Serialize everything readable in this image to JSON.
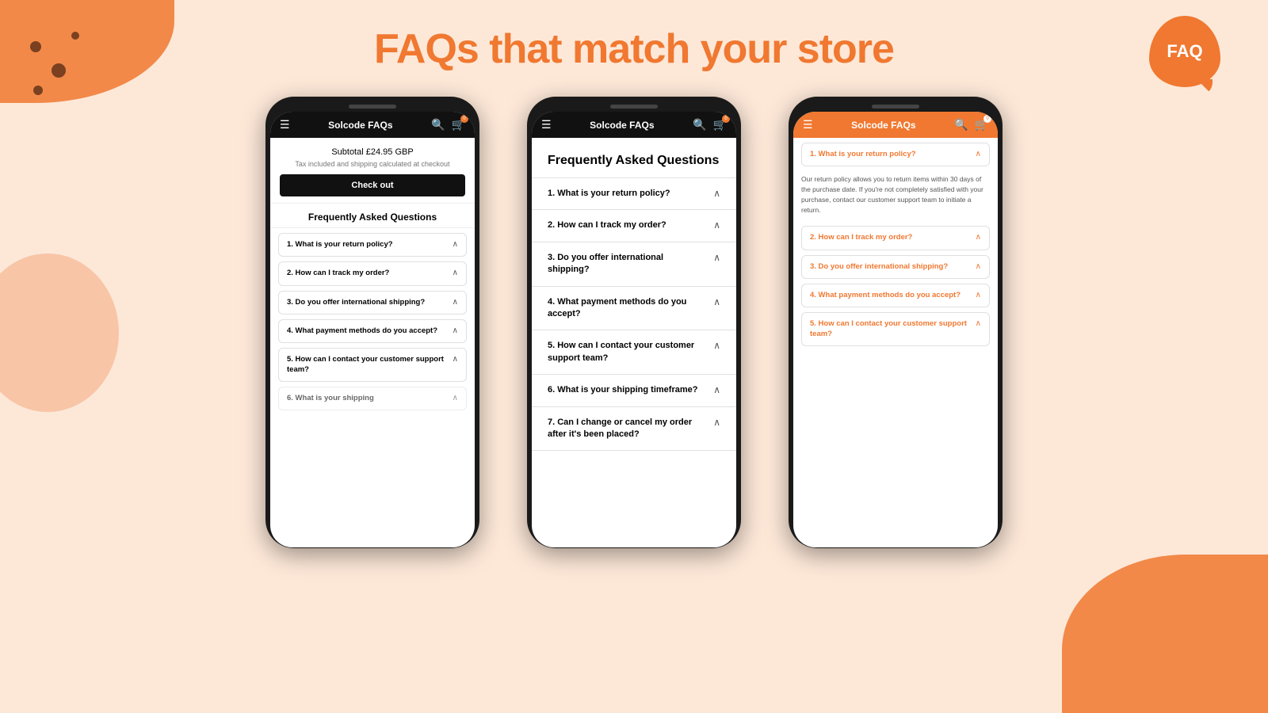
{
  "page": {
    "title": "FAQs that match your store",
    "background_color": "#fde8d8",
    "accent_color": "#f07830"
  },
  "faq_icon": {
    "label": "FAQ"
  },
  "phone1": {
    "nav": {
      "title": "Solcode FAQs",
      "theme": "dark"
    },
    "subtotal_label": "Subtotal",
    "subtotal_value": "£24.95 GBP",
    "shipping_note": "Tax included and shipping calculated at checkout",
    "checkout_button": "Check out",
    "faq_section_title": "Frequently Asked Questions",
    "faqs": [
      {
        "id": 1,
        "question": "1. What is your return policy?"
      },
      {
        "id": 2,
        "question": "2. How can I track my order?"
      },
      {
        "id": 3,
        "question": "3. Do you offer international shipping?"
      },
      {
        "id": 4,
        "question": "4. What payment methods do you accept?"
      },
      {
        "id": 5,
        "question": "5. How can I contact your customer support team?"
      },
      {
        "id": 6,
        "question": "6. What is your shipping"
      }
    ]
  },
  "phone2": {
    "nav": {
      "title": "Solcode FAQs",
      "theme": "dark"
    },
    "faq_main_title": "Frequently Asked Questions",
    "faqs": [
      {
        "id": 1,
        "question": "1. What is your return policy?"
      },
      {
        "id": 2,
        "question": "2. How can I track my order?"
      },
      {
        "id": 3,
        "question": "3. Do you offer international shipping?"
      },
      {
        "id": 4,
        "question": "4. What payment methods do you accept?"
      },
      {
        "id": 5,
        "question": "5. How can I contact your customer support team?"
      },
      {
        "id": 6,
        "question": "6. What is your shipping timeframe?"
      },
      {
        "id": 7,
        "question": "7. Can I change or cancel my order after it's been placed?"
      }
    ]
  },
  "phone3": {
    "nav": {
      "title": "Solcode FAQs",
      "theme": "orange"
    },
    "faqs": [
      {
        "id": 1,
        "question": "1. What is your return policy?",
        "expanded": true,
        "answer": "Our return policy allows you to return items within 30 days of the purchase date. If you're not completely satisfied with your purchase, contact our customer support team to initiate a return."
      },
      {
        "id": 2,
        "question": "2. How can I track my order?",
        "expanded": false
      },
      {
        "id": 3,
        "question": "3. Do you offer international shipping?",
        "expanded": false
      },
      {
        "id": 4,
        "question": "4. What payment methods do you accept?",
        "expanded": false
      },
      {
        "id": 5,
        "question": "5. How can I contact your customer support team?",
        "expanded": false
      }
    ]
  }
}
